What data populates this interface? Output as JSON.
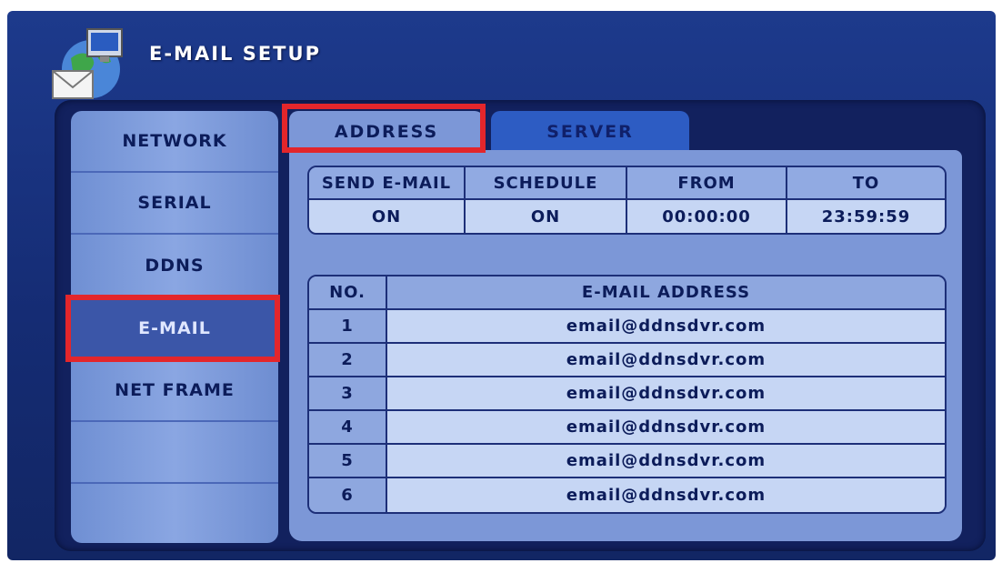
{
  "window": {
    "title": "E-MAIL SETUP"
  },
  "sidebar": {
    "items": [
      {
        "label": "NETWORK",
        "active": false
      },
      {
        "label": "SERIAL",
        "active": false
      },
      {
        "label": "DDNS",
        "active": false
      },
      {
        "label": "E-MAIL",
        "active": true
      },
      {
        "label": "NET FRAME",
        "active": false
      },
      {
        "label": "",
        "active": false
      },
      {
        "label": "",
        "active": false
      }
    ]
  },
  "tabs": [
    {
      "label": "ADDRESS",
      "active": true
    },
    {
      "label": "SERVER",
      "active": false
    }
  ],
  "schedule": {
    "headers": [
      "SEND E-MAIL",
      "SCHEDULE",
      "FROM",
      "TO"
    ],
    "values": [
      "ON",
      "ON",
      "00:00:00",
      "23:59:59"
    ]
  },
  "address_list": {
    "headers": [
      "NO.",
      "E-MAIL ADDRESS"
    ],
    "rows": [
      {
        "no": "1",
        "email": "email@ddnsdvr.com"
      },
      {
        "no": "2",
        "email": "email@ddnsdvr.com"
      },
      {
        "no": "3",
        "email": "email@ddnsdvr.com"
      },
      {
        "no": "4",
        "email": "email@ddnsdvr.com"
      },
      {
        "no": "5",
        "email": "email@ddnsdvr.com"
      },
      {
        "no": "6",
        "email": "email@ddnsdvr.com"
      }
    ]
  },
  "icons": {
    "title_icon": "email-setup-icon"
  },
  "colors": {
    "highlight": "#e3262b",
    "panel": "#7c97d7",
    "background": "#1d3a8c"
  }
}
